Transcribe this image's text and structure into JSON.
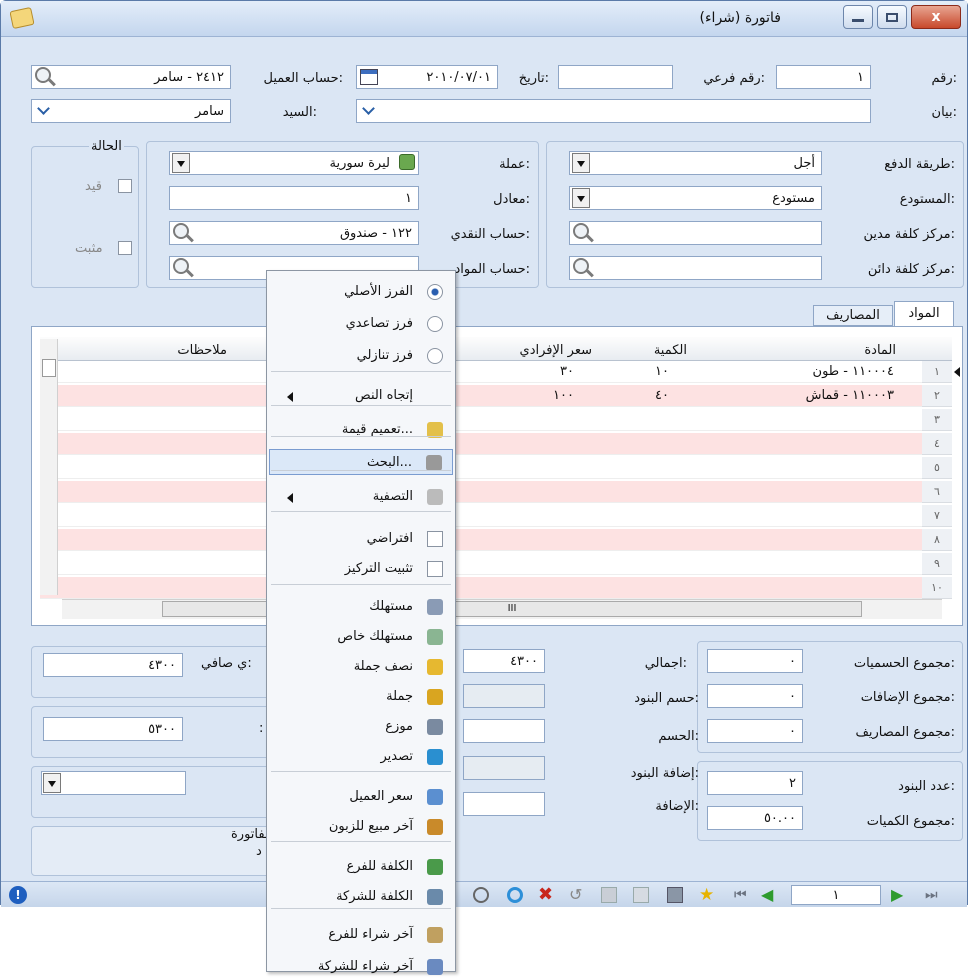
{
  "window": {
    "title": "فاتورة (شراء)",
    "close_label": "x"
  },
  "header": {
    "number_label": "رقم:",
    "number_value": "١",
    "subnumber_label": "رقم فرعي:",
    "subnumber_value": "",
    "date_label": "تاريخ:",
    "date_value": "٢٠١٠/٠٧/٠١",
    "customer_account_label": "حساب العميل:",
    "customer_account_value": "٢٤١٢ - سامر",
    "statement_label": "بيان:",
    "statement_value": "",
    "mister_label": "السيد:",
    "mister_value": "سامر"
  },
  "details": {
    "payment_label": "طريقة الدفع:",
    "payment_value": "أجل",
    "warehouse_label": "المستودع:",
    "warehouse_value": "مستودع",
    "debit_cost_label": "مركز كلفة مدين:",
    "debit_cost_value": "",
    "credit_cost_label": "مركز كلفة دائن:",
    "credit_cost_value": "",
    "currency_label": "عملة:",
    "currency_value": "ليرة سورية",
    "equivalent_label": "معادل:",
    "equivalent_value": "١",
    "cash_account_label": "حساب النقدي:",
    "cash_account_value": "١٢٢ - صندوق",
    "materials_account_label": "حساب المواد:",
    "materials_account_value": ""
  },
  "status": {
    "title": "الحالة",
    "recorded_label": "قيد",
    "posted_label": "مثبت"
  },
  "tabs": [
    "المواد",
    "المصاريف"
  ],
  "grid": {
    "columns": [
      "المادة",
      "الكمية",
      "سعر الإفرادي",
      "ملاحظات"
    ],
    "rows": [
      {
        "num": "١",
        "item": "١١٠٠٠٤ - طون",
        "qty": "١٠",
        "price": "٣٠"
      },
      {
        "num": "٢",
        "item": "١١٠٠٠٣ - قماش",
        "qty": "٤٠",
        "price": "١٠٠"
      },
      {
        "num": "٣"
      },
      {
        "num": "٤"
      },
      {
        "num": "٥"
      },
      {
        "num": "٦"
      },
      {
        "num": "٧"
      },
      {
        "num": "٨"
      },
      {
        "num": "٩"
      },
      {
        "num": "١٠"
      }
    ],
    "scroll_mark": "III"
  },
  "totals": {
    "discounts_total_label": "مجموع الحسميات:",
    "discounts_total_value": "٠",
    "additions_total_label": "مجموع الإضافات:",
    "additions_total_value": "٠",
    "expenses_total_label": "مجموع المصاريف:",
    "expenses_total_value": "٠",
    "items_count_label": "عدد البنود:",
    "items_count_value": "٢",
    "quantities_total_label": "مجموع الكميات:",
    "quantities_total_value": "٥٠.٠٠",
    "gross_label": "اجمالي:",
    "gross_value": "٤٣٠٠",
    "items_discount_label": "حسم البنود:",
    "discount_label": "الحسم:",
    "items_addition_label": "إضافة البنود:",
    "addition_label": "الإضافة:",
    "net_label": "ي صافي:",
    "net_value": "٤٣٠٠",
    "total2_label": ":",
    "total2_value": "٥٣٠٠",
    "invoice_label": "لفاتورة",
    "extra_label": "د"
  },
  "context_menu": {
    "items": [
      "الفرز الأصلي",
      "فرز تصاعدي",
      "فرز تنازلي",
      "إتجاه النص",
      "تعميم قيمة...",
      "البحث...",
      "التصفية",
      "افتراضي",
      "تثبيت التركيز",
      "مستهلك",
      "مستهلك خاص",
      "نصف جملة",
      "جملة",
      "موزع",
      "تصدير",
      "سعر العميل",
      "آخر مبيع للزبون",
      "الكلفة للفرع",
      "الكلفة للشركة",
      "آخر شراء للفرع",
      "آخر شراء للشركة"
    ]
  },
  "toolbar": {
    "page_value": "١"
  },
  "colors": {
    "pink_row": "#fde2e2",
    "highlight": "#dbe8f8",
    "window_bg": "#dbe6f4"
  }
}
